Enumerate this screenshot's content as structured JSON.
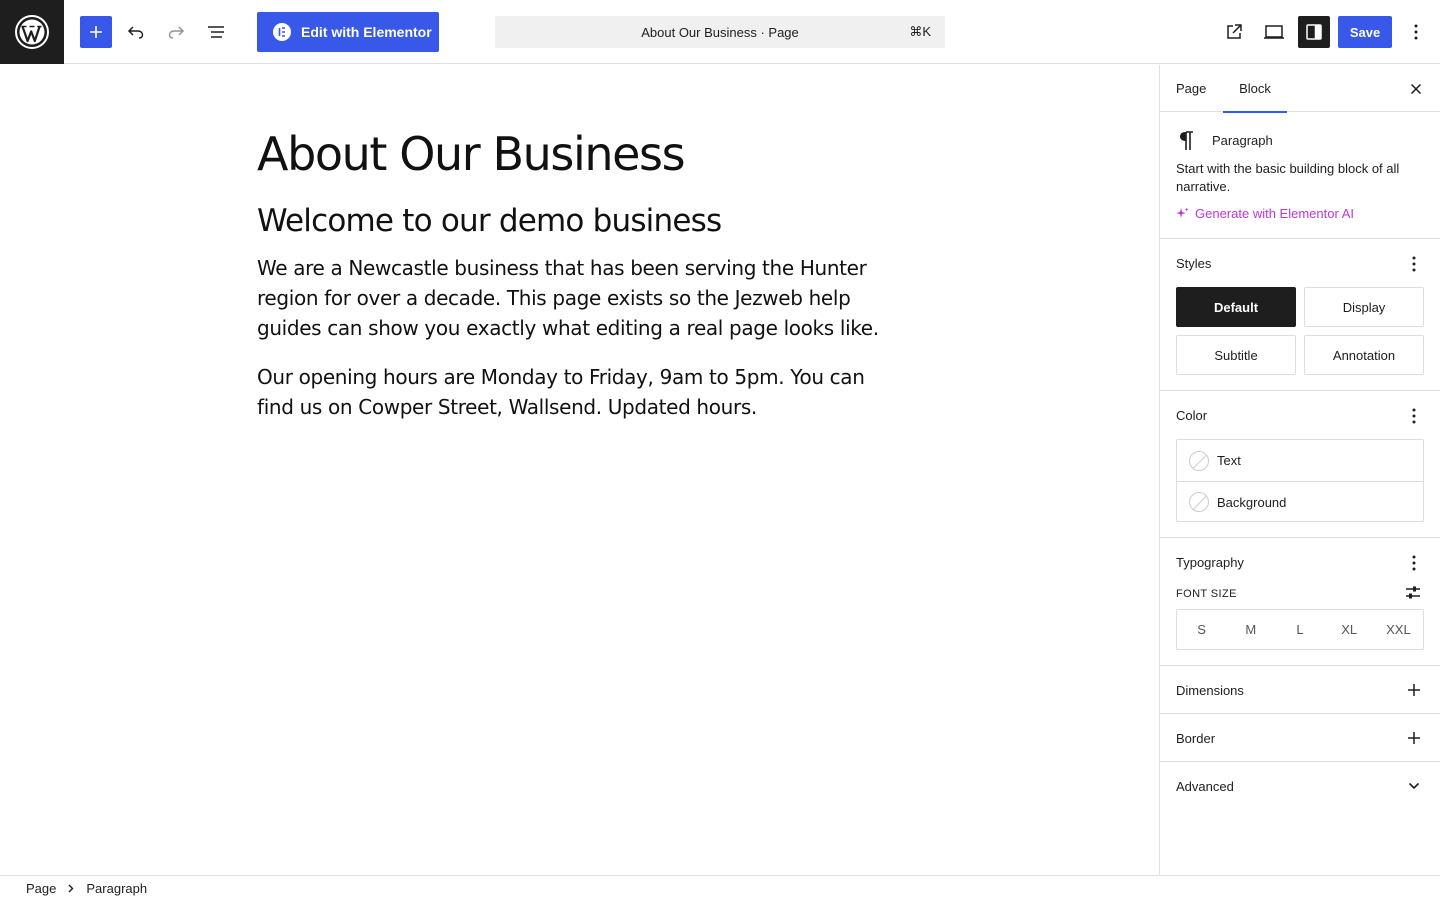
{
  "toolbar": {
    "elementor_label": "Edit with Elementor",
    "command_title": "About Our Business · Page",
    "command_shortcut": "⌘K",
    "save_label": "Save",
    "accent_color": "#3858e9"
  },
  "content": {
    "title": "About Our Business",
    "heading": "Welcome to our demo business",
    "paragraph_1": "We are a Newcastle business that has been serving the Hunter region for over a decade. This page exists so the Jezweb help guides can show you exactly what editing a real page looks like.",
    "paragraph_2": "Our opening hours are Monday to Friday, 9am to 5pm. You can find us on Cowper Street, Wallsend. Updated hours."
  },
  "sidebar": {
    "tabs": [
      {
        "label": "Page",
        "active": false
      },
      {
        "label": "Block",
        "active": true
      }
    ],
    "block": {
      "name": "Paragraph",
      "description": "Start with the basic building block of all narrative.",
      "ai_link": "Generate with Elementor AI",
      "ai_color": "#c036d6"
    },
    "styles": {
      "title": "Styles",
      "options": [
        {
          "label": "Default",
          "active": true
        },
        {
          "label": "Display",
          "active": false
        },
        {
          "label": "Subtitle",
          "active": false
        },
        {
          "label": "Annotation",
          "active": false
        }
      ]
    },
    "color": {
      "title": "Color",
      "items": [
        {
          "label": "Text"
        },
        {
          "label": "Background"
        }
      ]
    },
    "typography": {
      "title": "Typography",
      "font_size_label": "FONT SIZE",
      "sizes": [
        "S",
        "M",
        "L",
        "XL",
        "XXL"
      ]
    },
    "dimensions": {
      "title": "Dimensions"
    },
    "border": {
      "title": "Border"
    },
    "advanced": {
      "title": "Advanced"
    }
  },
  "footer": {
    "breadcrumbs": [
      "Page",
      "Paragraph"
    ]
  }
}
